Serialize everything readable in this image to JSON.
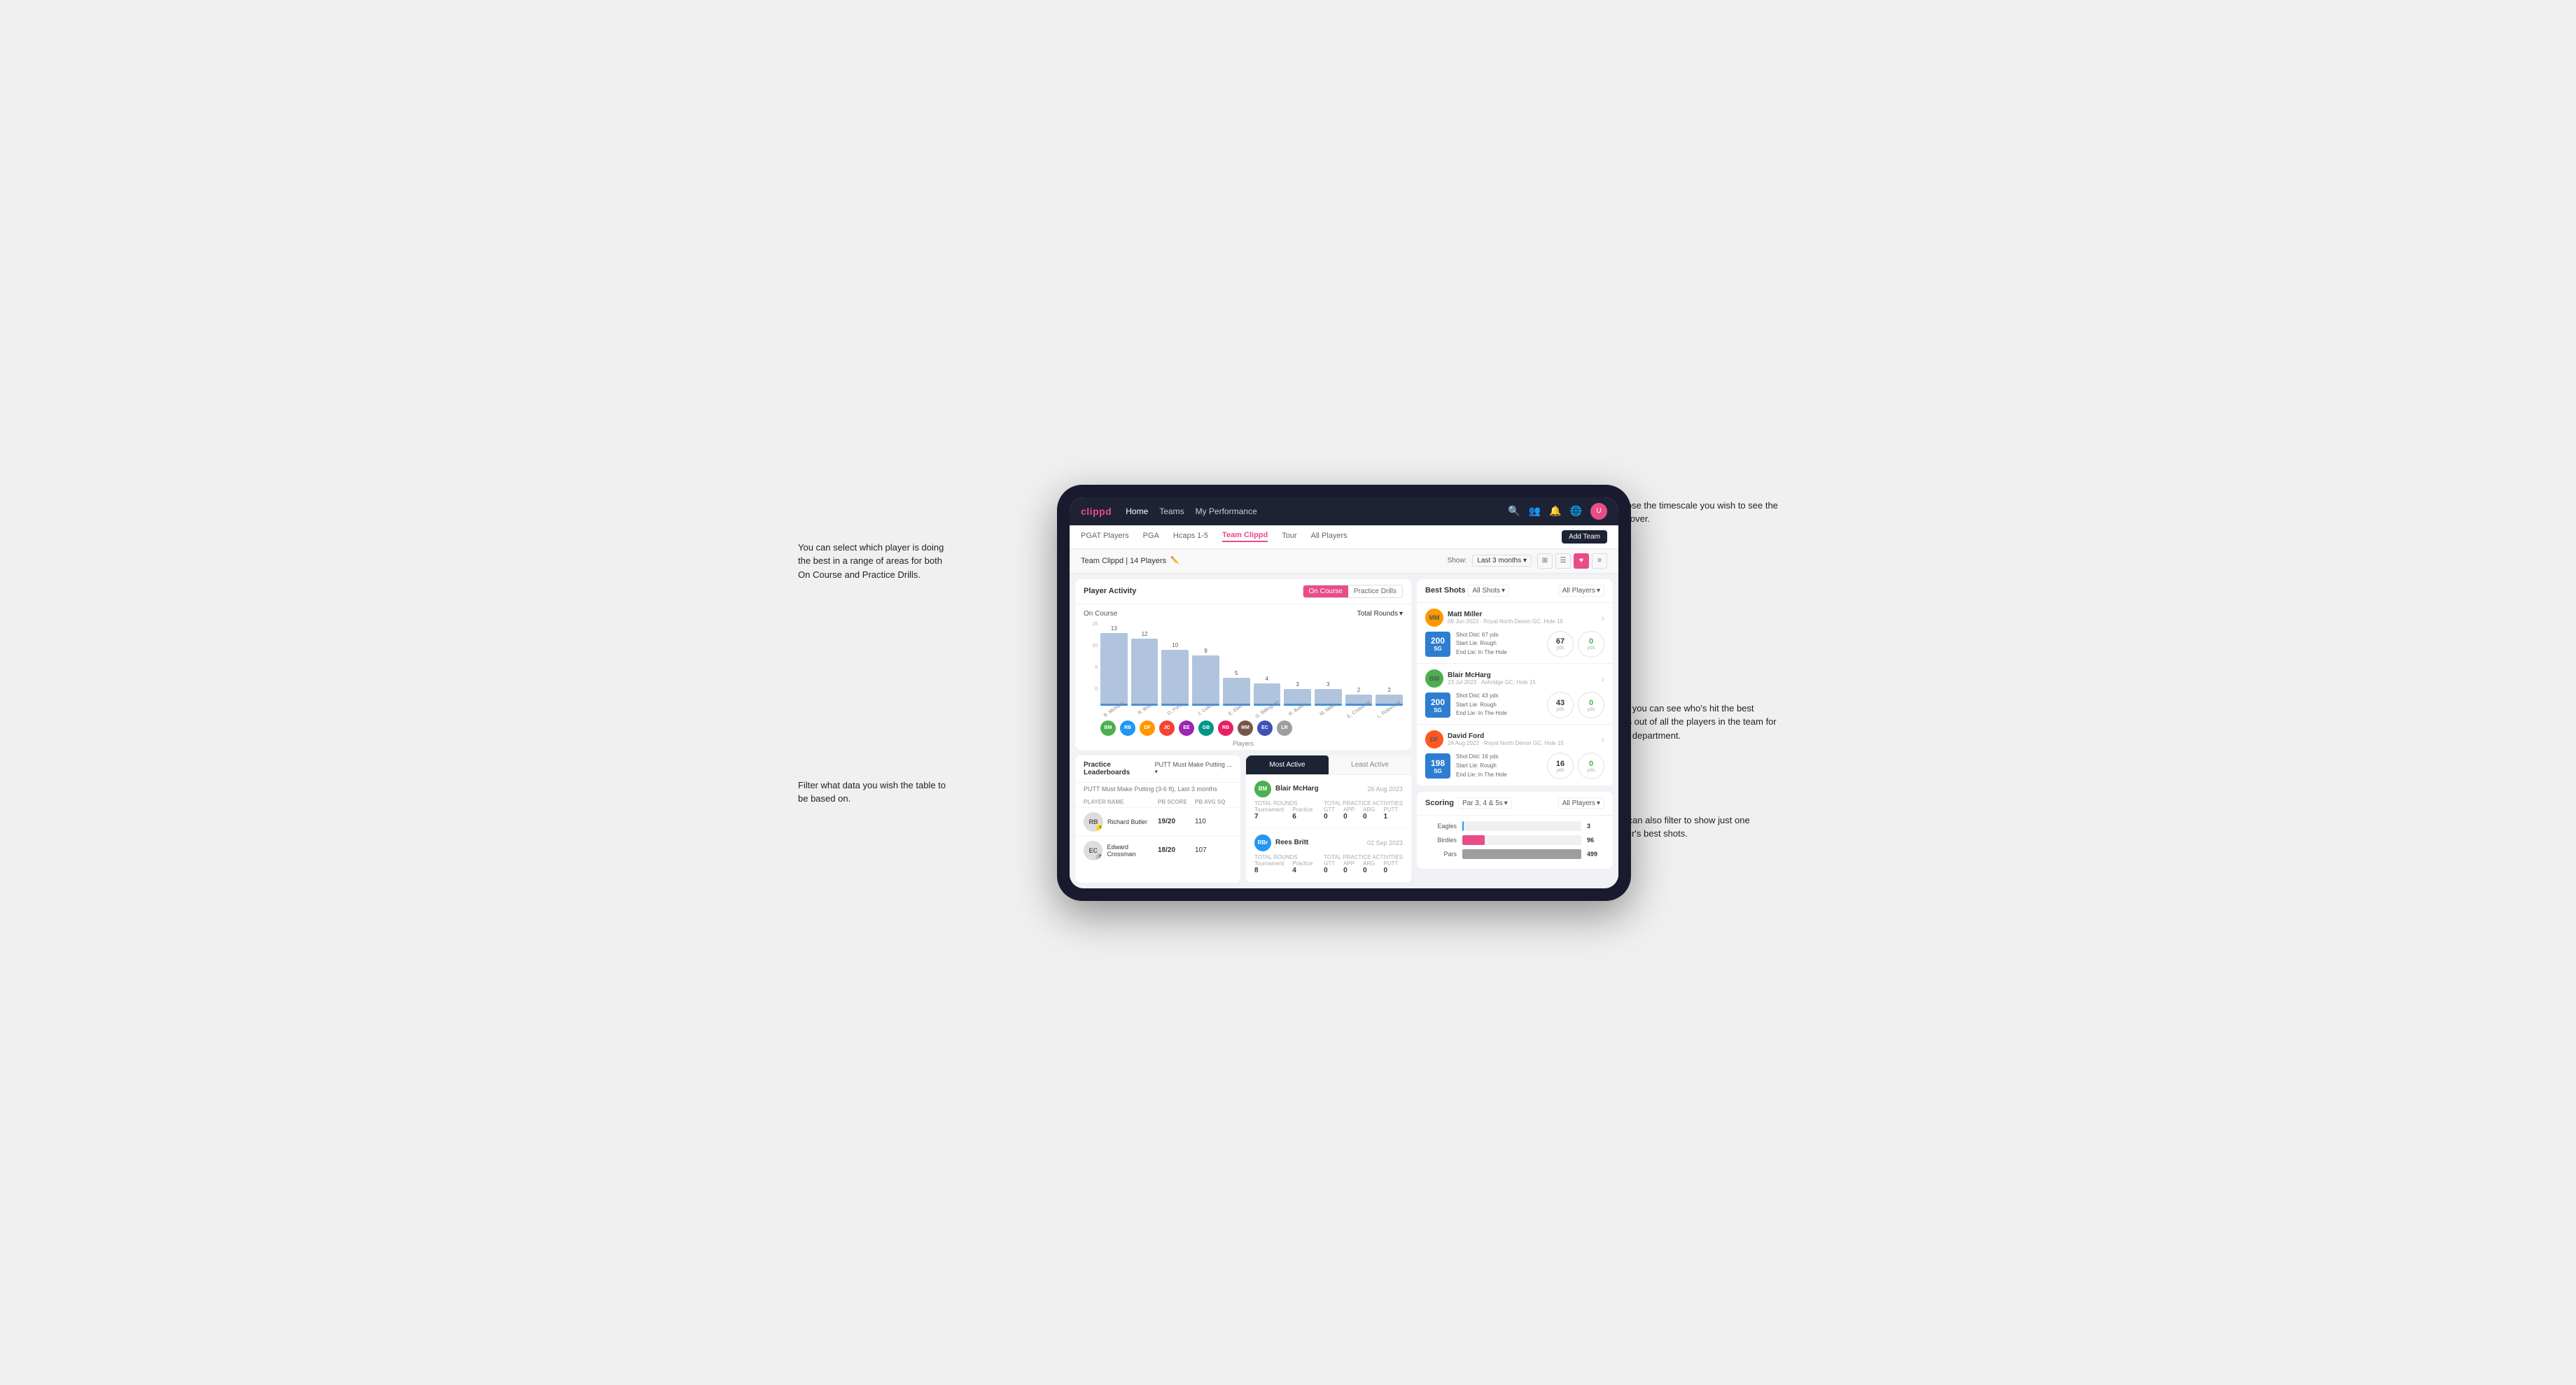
{
  "annotations": {
    "top_left": "You can select which player is doing the best in a range of areas for both On Course and Practice Drills.",
    "top_right": "Choose the timescale you wish to see the data over.",
    "filter": "Filter what data you wish the table to be based on.",
    "best_shots_right": "Here you can see who's hit the best shots out of all the players in the team for each department.",
    "filter_player": "You can also filter to show just one player's best shots."
  },
  "navbar": {
    "brand": "clippd",
    "links": [
      "Home",
      "Teams",
      "My Performance"
    ]
  },
  "subnav": {
    "items": [
      "PGAT Players",
      "PGA",
      "Hcaps 1-5",
      "Team Clippd",
      "Tour",
      "All Players"
    ],
    "active": "Team Clippd",
    "add_team_label": "Add Team"
  },
  "team_header": {
    "title": "Team Clippd | 14 Players",
    "show_label": "Show:",
    "show_value": "Last 3 months"
  },
  "player_activity": {
    "title": "Player Activity",
    "toggle": [
      "On Course",
      "Practice Drills"
    ],
    "active_toggle": "On Course",
    "sub_title": "On Course",
    "chart_dropdown": "Total Rounds",
    "y_labels": [
      "15",
      "10",
      "5",
      "0"
    ],
    "bars": [
      {
        "name": "B. McHarg",
        "value": 13,
        "initials": "BM",
        "color": "green"
      },
      {
        "name": "R. Britt",
        "value": 12,
        "initials": "RB",
        "color": "blue"
      },
      {
        "name": "D. Ford",
        "value": 10,
        "initials": "DF",
        "color": "orange"
      },
      {
        "name": "J. Coles",
        "value": 9,
        "initials": "JC",
        "color": "red"
      },
      {
        "name": "E. Ebert",
        "value": 5,
        "initials": "EE",
        "color": "purple"
      },
      {
        "name": "G. Billingham",
        "value": 4,
        "initials": "GB",
        "color": "teal"
      },
      {
        "name": "R. Butler",
        "value": 3,
        "initials": "RBu",
        "color": "pink"
      },
      {
        "name": "M. Miller",
        "value": 3,
        "initials": "MM",
        "color": "brown"
      },
      {
        "name": "E. Crossman",
        "value": 2,
        "initials": "EC",
        "color": "indigo"
      },
      {
        "name": "L. Robertson",
        "value": 2,
        "initials": "LR",
        "color": "gray"
      }
    ],
    "x_label": "Players"
  },
  "practice_leaderboards": {
    "title": "Practice Leaderboards",
    "dropdown": "PUTT Must Make Putting ...",
    "sub_label": "PUTT Must Make Putting (3-6 ft), Last 3 months",
    "columns": [
      "PLAYER NAME",
      "PB SCORE",
      "PB AVG SQ"
    ],
    "players": [
      {
        "name": "Richard Butler",
        "initials": "RB",
        "rank": 1,
        "pb_score": "19/20",
        "pb_avg": "110"
      },
      {
        "name": "Edward Crossman",
        "initials": "EC",
        "rank": 2,
        "pb_score": "18/20",
        "pb_avg": "107"
      }
    ]
  },
  "most_active": {
    "tabs": [
      "Most Active",
      "Least Active"
    ],
    "active_tab": "Most Active",
    "players": [
      {
        "name": "Blair McHarg",
        "initials": "BM",
        "date": "26 Aug 2023",
        "total_rounds_label": "Total Rounds",
        "tournament": "7",
        "practice": "6",
        "total_practice_label": "Total Practice Activities",
        "gtt": "0",
        "app": "0",
        "arg": "0",
        "putt": "1"
      },
      {
        "name": "Rees Britt",
        "initials": "RBr",
        "date": "02 Sep 2023",
        "total_rounds_label": "Total Rounds",
        "tournament": "8",
        "practice": "4",
        "total_practice_label": "Total Practice Activities",
        "gtt": "0",
        "app": "0",
        "arg": "0",
        "putt": "0"
      }
    ]
  },
  "best_shots": {
    "title": "Best Shots",
    "filter1": "All Shots",
    "filter1_icon": "▾",
    "filter2": "All Players",
    "filter2_icon": "▾",
    "shots": [
      {
        "player": "Matt Miller",
        "details": "09 Jun 2023 · Royal North Devon GC, Hole 15",
        "badge_sg": "200",
        "shot_dist": "Shot Dist: 67 yds",
        "start_lie": "Start Lie: Rough",
        "end_lie": "End Lie: In The Hole",
        "metric1_val": "67",
        "metric1_unit": "yds",
        "metric2_val": "0",
        "metric2_unit": "yds"
      },
      {
        "player": "Blair McHarg",
        "details": "23 Jul 2023 · Ashridge GC, Hole 15",
        "badge_sg": "200",
        "shot_dist": "Shot Dist: 43 yds",
        "start_lie": "Start Lie: Rough",
        "end_lie": "End Lie: In The Hole",
        "metric1_val": "43",
        "metric1_unit": "yds",
        "metric2_val": "0",
        "metric2_unit": "yds"
      },
      {
        "player": "David Ford",
        "details": "24 Aug 2023 · Royal North Devon GC, Hole 15",
        "badge_sg": "198",
        "shot_dist": "Shot Dist: 16 yds",
        "start_lie": "Start Lie: Rough",
        "end_lie": "End Lie: In The Hole",
        "metric1_val": "16",
        "metric1_unit": "yds",
        "metric2_val": "0",
        "metric2_unit": "yds"
      }
    ]
  },
  "scoring": {
    "title": "Scoring",
    "filter1": "Par 3, 4 & 5s",
    "filter1_icon": "▾",
    "filter2": "All Players",
    "filter2_icon": "▾",
    "rows": [
      {
        "label": "Eagles",
        "value": 3,
        "max": 499,
        "bar_class": "eagles",
        "color": "#2196f3"
      },
      {
        "label": "Birdies",
        "value": 96,
        "max": 499,
        "bar_class": "birdies",
        "color": "#e84d8a"
      },
      {
        "label": "Pars",
        "value": 499,
        "max": 499,
        "bar_class": "pars",
        "color": "#9e9e9e"
      }
    ]
  }
}
